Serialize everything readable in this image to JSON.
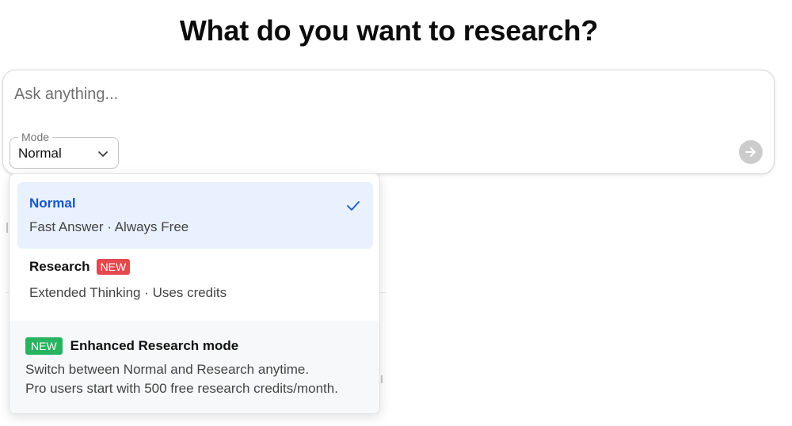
{
  "page": {
    "title": "What do you want to research?"
  },
  "composer": {
    "placeholder": "Ask anything...",
    "value": ""
  },
  "mode": {
    "legend": "Mode",
    "selected": "Normal"
  },
  "send": {
    "icon": "arrow-right-icon"
  },
  "dropdown": {
    "options": [
      {
        "title": "Normal",
        "description": "Fast Answer · Always Free",
        "selected": true,
        "badge": ""
      },
      {
        "title": "Research",
        "description": "Extended Thinking · Uses credits",
        "selected": false,
        "badge": "NEW"
      }
    ],
    "info": {
      "badge": "NEW",
      "title": "Enhanced Research mode",
      "line1": "Switch between Normal and Research anytime.",
      "line2": "Pro users start with 500 free research credits/month."
    }
  },
  "colors": {
    "selected_bg": "#e8f1fd",
    "selected_text": "#1a56c9",
    "badge_red": "#e5484d",
    "badge_green": "#27b35f",
    "send_disabled": "#cccccc"
  }
}
